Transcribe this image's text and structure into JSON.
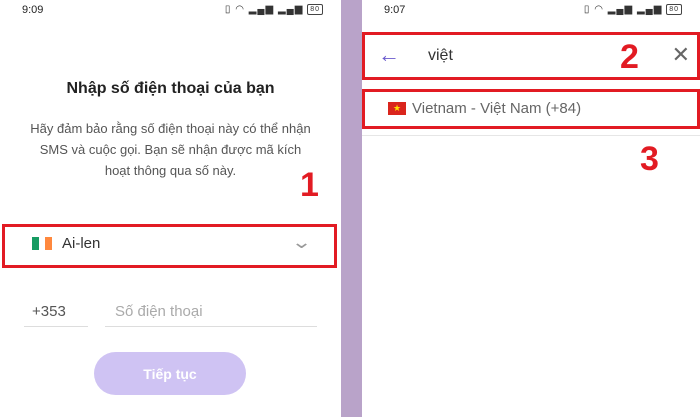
{
  "left": {
    "status": {
      "time": "9:09",
      "battery": "80"
    },
    "title": "Nhập số điện thoại của bạn",
    "description": "Hãy đảm bảo rằng số điện thoại này có thể nhận SMS và cuộc gọi. Bạn sẽ nhận được mã kích hoạt thông qua số này.",
    "country": {
      "name": "Ai-len",
      "flag_colors": [
        "#169b62",
        "#ffffff",
        "#ff883e"
      ]
    },
    "dial_code": "+353",
    "phone_placeholder": "Số điện thoại",
    "continue_label": "Tiếp tục",
    "marker": "1"
  },
  "right": {
    "status": {
      "time": "9:07",
      "battery": "80"
    },
    "search_query": "việt",
    "result": "Vietnam - Việt Nam (+84)",
    "markers": [
      "2",
      "3"
    ]
  },
  "colors": {
    "highlight": "#e21b23",
    "accent": "#6a5acd",
    "button": "#cfc3f3"
  }
}
